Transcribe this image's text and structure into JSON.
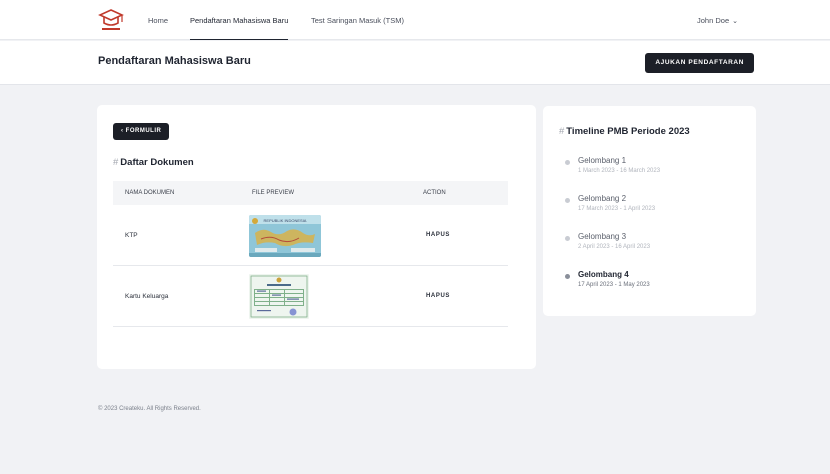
{
  "nav": {
    "logo_alt": "Createku",
    "items": [
      {
        "label": "Home"
      },
      {
        "label": "Pendaftaran Mahasiswa Baru"
      },
      {
        "label": "Test Saringan Masuk (TSM)"
      }
    ],
    "user": "John Doe"
  },
  "header": {
    "title": "Pendaftaran Mahasiswa Baru",
    "submit_label": "AJUKAN PENDAFTARAN"
  },
  "documents": {
    "back_label": "FORMULIR",
    "title": "Daftar Dokumen",
    "columns": [
      "NAMA DOKUMEN",
      "FILE PREVIEW",
      "ACTION"
    ],
    "rows": [
      {
        "name": "KTP",
        "preview_title": "REPUBLIK INDONESIA",
        "action": "HAPUS"
      },
      {
        "name": "Kartu Keluarga",
        "action": "HAPUS"
      }
    ]
  },
  "timeline": {
    "title": "Timeline PMB Periode 2023",
    "items": [
      {
        "name": "Gelombang 1",
        "date": "1 March 2023 - 16 March 2023"
      },
      {
        "name": "Gelombang 2",
        "date": "17 March 2023 - 1 April 2023"
      },
      {
        "name": "Gelombang 3",
        "date": "2 April 2023 - 16 April 2023"
      },
      {
        "name": "Gelombang 4",
        "date": "17 April 2023 - 1 May 2023"
      }
    ]
  },
  "footer": {
    "text": "© 2023 Createku. All Rights Reserved."
  },
  "colors": {
    "primary_dark": "#1c1f27",
    "logo_red": "#c0392b",
    "background": "#f1f2f5"
  }
}
